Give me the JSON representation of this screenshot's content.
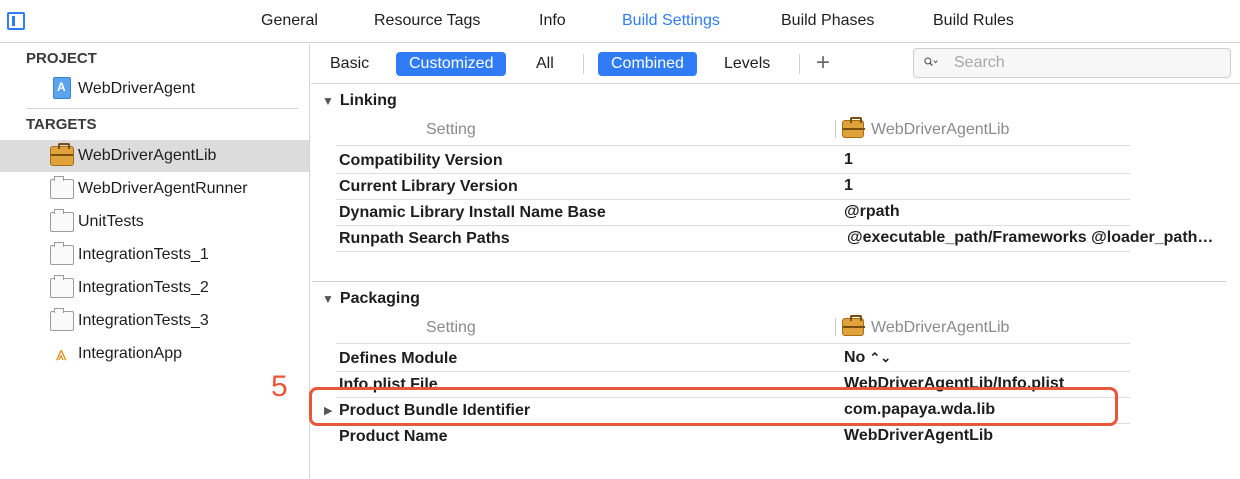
{
  "topbar": {
    "tabs": [
      {
        "label": "General"
      },
      {
        "label": "Resource Tags"
      },
      {
        "label": "Info"
      },
      {
        "label": "Build Settings"
      },
      {
        "label": "Build Phases"
      },
      {
        "label": "Build Rules"
      }
    ],
    "active_tab": "Build Settings",
    "accent_color": "#2f7cf6"
  },
  "sidebar": {
    "project_header": "PROJECT",
    "project": {
      "label": "WebDriverAgent",
      "icon": "project-file-icon"
    },
    "targets_header": "TARGETS",
    "targets": [
      {
        "label": "WebDriverAgentLib",
        "icon": "briefcase-icon",
        "selected": true
      },
      {
        "label": "WebDriverAgentRunner",
        "icon": "target-icon"
      },
      {
        "label": "UnitTests",
        "icon": "target-icon"
      },
      {
        "label": "IntegrationTests_1",
        "icon": "target-icon"
      },
      {
        "label": "IntegrationTests_2",
        "icon": "target-icon"
      },
      {
        "label": "IntegrationTests_3",
        "icon": "target-icon"
      },
      {
        "label": "IntegrationApp",
        "icon": "app-icon"
      }
    ]
  },
  "filterbar": {
    "basic": "Basic",
    "customized": "Customized",
    "all": "All",
    "combined": "Combined",
    "levels": "Levels",
    "add": "+",
    "search_placeholder": "Search"
  },
  "sections": {
    "linking": {
      "title": "Linking",
      "setting_header": "Setting",
      "target_header": "WebDriverAgentLib",
      "rows": [
        {
          "name": "Compatibility Version",
          "value": "1"
        },
        {
          "name": "Current Library Version",
          "value": "1"
        },
        {
          "name": "Dynamic Library Install Name Base",
          "value": "@rpath"
        },
        {
          "name": "Runpath Search Paths",
          "value": "@executable_path/Frameworks @loader_path…"
        }
      ]
    },
    "packaging": {
      "title": "Packaging",
      "setting_header": "Setting",
      "target_header": "WebDriverAgentLib",
      "rows": [
        {
          "name": "Defines Module",
          "value": "No"
        },
        {
          "name": "Info.plist File",
          "value": "WebDriverAgentLib/Info.plist"
        },
        {
          "name": "Product Bundle Identifier",
          "value": "com.papaya.wda.lib"
        },
        {
          "name": "Product Name",
          "value": "WebDriverAgentLib"
        }
      ]
    }
  },
  "annotation": {
    "number": "5",
    "color": "#e8573c"
  }
}
